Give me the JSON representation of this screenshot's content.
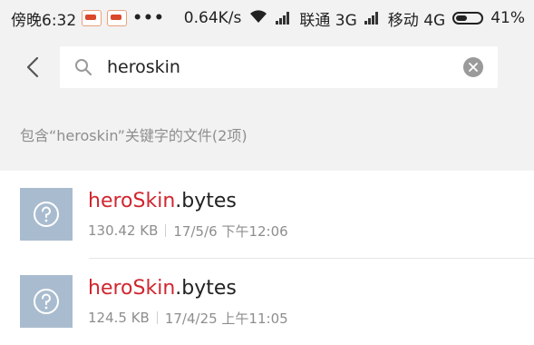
{
  "status_bar": {
    "time": "傍晚6:32",
    "dots": "•••",
    "speed": "0.64K/s",
    "carrier1": "联通 3G",
    "carrier2": "移动 4G",
    "battery": "41%"
  },
  "search": {
    "value": "heroskin",
    "placeholder": ""
  },
  "results": {
    "header": "包含“heroskin”关键字的文件(2项)",
    "files": [
      {
        "name_highlight": "heroSkin",
        "name_rest": ".bytes",
        "size": "130.42 KB",
        "date": "17/5/6 下午12:06"
      },
      {
        "name_highlight": "heroSkin",
        "name_rest": ".bytes",
        "size": "124.5 KB",
        "date": "17/4/25 上午11:05"
      }
    ]
  },
  "colors": {
    "highlight": "#d0262f",
    "icon_bg": "#a9bccf",
    "bar_bg": "#f2f2f2"
  },
  "icons": [
    "back-icon",
    "search-icon",
    "clear-icon",
    "unknown-file-icon",
    "wifi-icon",
    "signal-icon",
    "battery-icon"
  ]
}
